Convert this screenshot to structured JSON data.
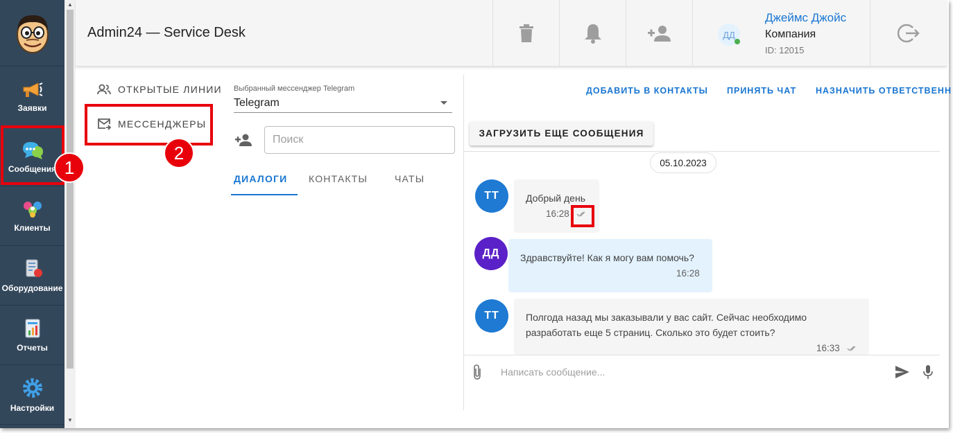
{
  "header": {
    "app_title": "Admin24 — Service Desk",
    "user": {
      "initials": "ДД",
      "name": "Джеймс Джойс",
      "company": "Компания",
      "id_label": "ID: 12015"
    }
  },
  "nav": {
    "items": [
      {
        "label": "Заявки",
        "icon": "megaphone-icon"
      },
      {
        "label": "Сообщения",
        "icon": "chat-bubbles-icon"
      },
      {
        "label": "Клиенты",
        "icon": "clients-icon"
      },
      {
        "label": "Оборудование",
        "icon": "equipment-icon"
      },
      {
        "label": "Отчеты",
        "icon": "reports-icon"
      },
      {
        "label": "Настройки",
        "icon": "gear-icon"
      }
    ]
  },
  "lines": {
    "open_lines": "ОТКРЫТЫЕ ЛИНИИ",
    "messengers": "МЕССЕНДЖЕРЫ"
  },
  "messenger_select": {
    "label": "Выбранный мессенджер Telegram",
    "value": "Telegram"
  },
  "search": {
    "placeholder": "Поиск"
  },
  "tabs": [
    {
      "label": "ДИАЛОГИ",
      "active": true
    },
    {
      "label": "КОНТАКТЫ",
      "active": false
    },
    {
      "label": "ЧАТЫ",
      "active": false
    }
  ],
  "chat": {
    "actions": {
      "add_contacts": "ДОБАВИТЬ В КОНТАКТЫ",
      "accept_chat": "ПРИНЯТЬ ЧАТ",
      "assign": "НАЗНАЧИТЬ ОТВЕТСТВЕНН"
    },
    "load_more": "ЗАГРУЗИТЬ ЕЩЕ СООБЩЕНИЯ",
    "date": "05.10.2023",
    "messages": [
      {
        "initials": "ТТ",
        "text": "Добрый день",
        "time": "16:28",
        "own": false
      },
      {
        "initials": "ДД",
        "text": "Здравствуйте! Как я могу вам помочь?",
        "time": "16:28",
        "own": true
      },
      {
        "initials": "ТТ",
        "text": "Полгода назад мы заказывали у вас сайт. Сейчас необходимо разработать еще 5 страниц. Сколько это будет стоить?",
        "time": "16:33",
        "own": false
      }
    ],
    "input_placeholder": "Написать сообщение..."
  },
  "annotations": {
    "badge_1": "1",
    "badge_2": "2"
  },
  "colors": {
    "nav_bg": "#33475b",
    "accent": "#1976d2",
    "annotation_red": "#e8000b",
    "avatar_tt": "#1e7ad2",
    "avatar_dd": "#5b21c8",
    "own_bubble": "#e3f2fd"
  }
}
